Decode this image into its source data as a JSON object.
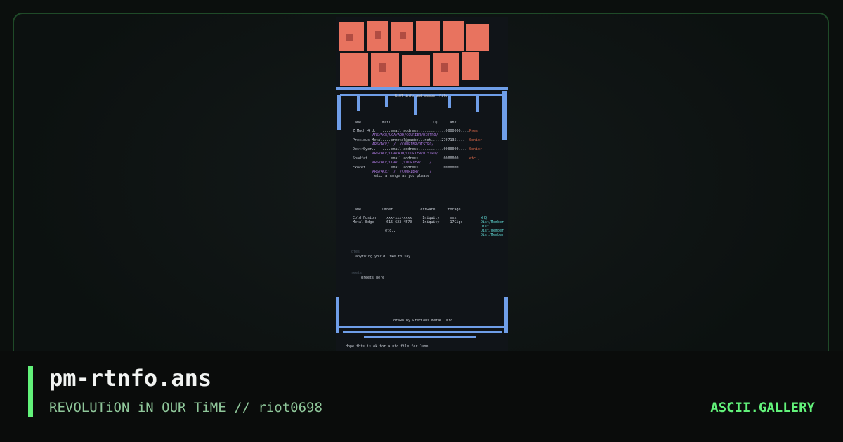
{
  "card": {
    "title": "pm-rtnfo.ans",
    "subtitle": "REVOLUTiON iN OUR TiME // riot0698",
    "brand": "ASCII.GALLERY",
    "accent_color": "#62f27a"
  },
  "art": {
    "header_caption": "RiOT info and member File",
    "members_header": " ame          mail                    CQ      ank",
    "members": [
      {
        "line": "Z Much 4 U........email address.............0000000....",
        "rank": "Pres",
        "groups": "    ARS/ACE/UGA/AOD/COURIER/DISTRO/"
      },
      {
        "line": "Precious Metal....prmetal@pacbell.net.....2707135....",
        "rank": "Senior",
        "groups": "    ARS/ACE/  /  /COURIER/DISTRO/"
      },
      {
        "line": "Destr0yer.........email address............0000000....",
        "rank": "Senior",
        "groups": "    ARS/ACE/UGA/AOD/COURIER/DISTRO/"
      },
      {
        "line": "Shadfat...........email address............0000000....",
        "rank": "etc.,",
        "groups": "    ARS/ACE/UGA/  /COURIER/    /"
      },
      {
        "line": "Exocet............email address............0000000....",
        "rank": "",
        "groups": "    ARS/ACE/  /  /COURIER/     /"
      }
    ],
    "members_footer": "     etc.,arrange as you please",
    "boards_header": " ame          umber             oftware      torage",
    "boards": [
      {
        "line": "Cold Fusion     xxx-xxx-xxxx     Iniquity     xxx",
        "tag": "WHQ"
      },
      {
        "line": "Metal Edge      615-623-4570     Iniquity     17Gigs",
        "tag": "Dist/Member"
      }
    ],
    "boards_extra_tags": [
      "Dist",
      "Dist/Member",
      "Dist/Member"
    ],
    "boards_footer": "          etc.,",
    "notes_label": "otes",
    "notes_text": "anything you'd like to say",
    "greets_label": "reets",
    "greets_text": "greets here",
    "credit": "drawn by Precious Metal  Rio",
    "footer": "Hope this is ok for a nfo file for June."
  }
}
